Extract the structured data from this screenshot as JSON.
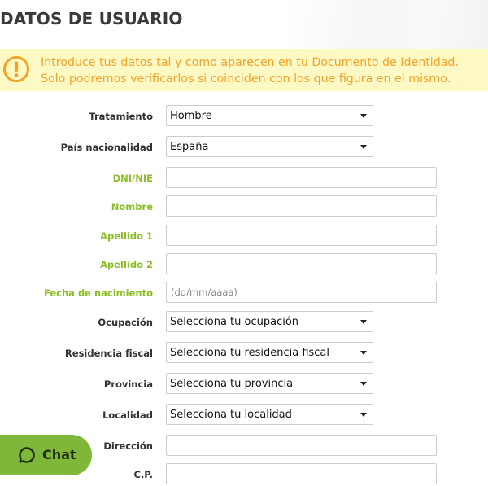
{
  "page": {
    "title": "DATOS DE USUARIO"
  },
  "notice": {
    "icon": "warning-circle-icon",
    "color": "#f2a32a",
    "background": "#fdf9c4",
    "text": "Introduce tus datos tal y como aparecen en tu Documento de Identidad. Solo podremos verificarlos si coinciden con los que figura en el mismo."
  },
  "form": {
    "required_label_color": "#8bbf2a",
    "tratamiento": {
      "label": "Tratamiento",
      "value": "Hombre"
    },
    "nacionalidad": {
      "label": "País nacionalidad",
      "value": "España"
    },
    "dni": {
      "label": "DNI/NIE",
      "value": ""
    },
    "nombre": {
      "label": "Nombre",
      "value": ""
    },
    "apellido1": {
      "label": "Apellido 1",
      "value": ""
    },
    "apellido2": {
      "label": "Apellido 2",
      "value": ""
    },
    "fecha": {
      "label": "Fecha de nacimiento",
      "placeholder": "(dd/mm/aaaa)",
      "value": ""
    },
    "ocupacion": {
      "label": "Ocupación",
      "value": "Selecciona tu ocupación"
    },
    "residencia": {
      "label": "Residencia fiscal",
      "value": "Selecciona tu residencia fiscal"
    },
    "provincia": {
      "label": "Provincia",
      "value": "Selecciona tu provincia"
    },
    "localidad": {
      "label": "Localidad",
      "value": "Selecciona tu localidad"
    },
    "direccion": {
      "label": "Dirección",
      "value": ""
    },
    "cp": {
      "label": "C.P.",
      "value": ""
    }
  },
  "chat": {
    "label": "Chat",
    "icon": "chat-bubble-icon",
    "color": "#7fb73a"
  }
}
